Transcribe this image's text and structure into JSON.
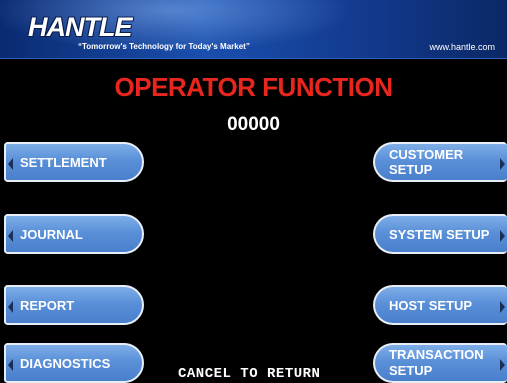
{
  "header": {
    "logo_text": "HANTLE",
    "slogan": "“Tomorrow's Technology for Today's Market”",
    "website": "www.hantle.com"
  },
  "screen": {
    "title": "OPERATOR FUNCTION",
    "code": "00000"
  },
  "left_buttons": [
    {
      "label": "SETTLEMENT"
    },
    {
      "label": "JOURNAL"
    },
    {
      "label": "REPORT"
    },
    {
      "label": "DIAGNOSTICS"
    }
  ],
  "right_buttons": [
    {
      "label": "CUSTOMER SETUP"
    },
    {
      "label": "SYSTEM SETUP"
    },
    {
      "label": "HOST SETUP"
    },
    {
      "label_line1": "TRANSACTION",
      "label_line2": "SETUP"
    }
  ],
  "footer": {
    "cancel_text": "CANCEL TO RETURN"
  },
  "colors": {
    "title_red": "#e8261e",
    "button_blue": "#5a90d8",
    "header_blue": "#1a4fae"
  }
}
